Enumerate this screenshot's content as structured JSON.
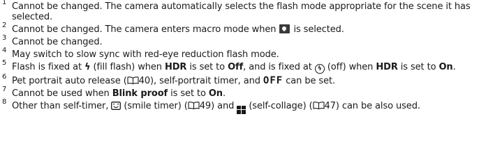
{
  "notes": [
    {
      "num": "1",
      "text": "Cannot be changed. The camera automatically selects the flash mode appropriate for the scene it has selected."
    },
    {
      "num": "2",
      "text_a": "Cannot be changed. The camera enters macro mode when ",
      "text_b": " is selected."
    },
    {
      "num": "3",
      "text": "Cannot be changed."
    },
    {
      "num": "4",
      "text": "May switch to slow sync with red-eye reduction flash mode."
    },
    {
      "num": "5",
      "text_a": "Flash is fixed at ",
      "text_b": " (fill flash) when ",
      "bold_1": "HDR",
      "text_c": " is set to ",
      "bold_2": "Off",
      "text_d": ", and is fixed at ",
      "text_e": " (off) when ",
      "bold_3": "HDR",
      "text_f": " is set to ",
      "bold_4": "On",
      "text_g": "."
    },
    {
      "num": "6",
      "text_a": "Pet portrait auto release (",
      "ref_1": "40",
      "text_b": "), self-portrait timer, and ",
      "off_label": "OFF",
      "text_c": " can be set."
    },
    {
      "num": "7",
      "text_a": "Cannot be used when ",
      "bold_1": "Blink proof",
      "text_b": " is set to ",
      "bold_2": "On",
      "text_c": "."
    },
    {
      "num": "8",
      "text_a": "Other than self-timer, ",
      "text_b": " (smile timer) (",
      "ref_1": "49",
      "text_c": ") and ",
      "text_d": " (self-collage) (",
      "ref_2": "47",
      "text_e": ") can be also used."
    }
  ],
  "icons": {
    "bolt": "⚡",
    "off_mark": "⚡"
  }
}
